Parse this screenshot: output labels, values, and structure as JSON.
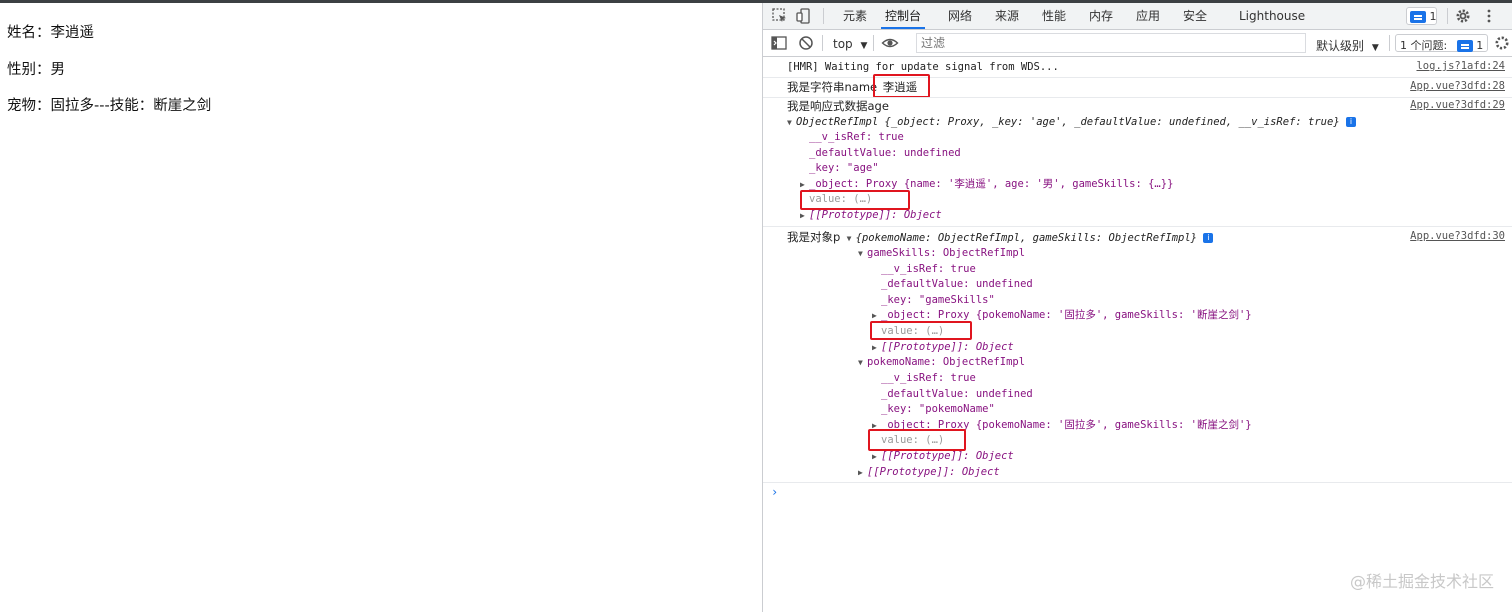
{
  "page": {
    "line1": "姓名：李逍遥",
    "line2": "性别：男",
    "line3": "宠物：固拉多---技能：断崖之剑"
  },
  "devtools": {
    "tabs": [
      "元素",
      "控制台",
      "网络",
      "来源",
      "性能",
      "内存",
      "应用",
      "安全",
      "Lighthouse"
    ],
    "active_tab": "控制台",
    "issues_badge": "1",
    "toolbar": {
      "context": "top",
      "filter_placeholder": "过滤",
      "level": "默认级别",
      "issues_label": "1 个问题:",
      "issues_count": "1"
    }
  },
  "console": {
    "hmr": "[HMR] Waiting for update signal from WDS...",
    "hmr_src": "log.js?1afd:24",
    "msg1_label": "我是字符串name",
    "msg1_value": "李逍遥",
    "msg1_src": "App.vue?3dfd:28",
    "msg2_label": "我是响应式数据age",
    "msg2_src": "App.vue?3dfd:29",
    "msg2_summary": "ObjectRefImpl {_object: Proxy, _key: 'age', _defaultValue: undefined, __v_isRef: true}",
    "msg2_props": {
      "isref": "__v_isRef: true",
      "default": "_defaultValue: undefined",
      "key": "_key: \"age\"",
      "object": "_object: Proxy {name: '李逍遥', age: '男', gameSkills: {…}}",
      "value": "value: (…)",
      "proto": "[[Prototype]]: Object"
    },
    "msg3_label": "我是对象p",
    "msg3_src": "App.vue?3dfd:30",
    "msg3_summary": "{pokemoName: ObjectRefImpl, gameSkills: ObjectRefImpl}",
    "gameSkills": {
      "head": "gameSkills: ObjectRefImpl",
      "isref": "__v_isRef: true",
      "default": "_defaultValue: undefined",
      "key": "_key: \"gameSkills\"",
      "object": "_object: Proxy {pokemoName: '固拉多', gameSkills: '断崖之剑'}",
      "value": "value: (…)",
      "proto": "[[Prototype]]: Object"
    },
    "pokemoName": {
      "head": "pokemoName: ObjectRefImpl",
      "isref": "__v_isRef: true",
      "default": "_defaultValue: undefined",
      "key": "_key: \"pokemoName\"",
      "object": "_object: Proxy {pokemoName: '固拉多', gameSkills: '断崖之剑'}",
      "value": "value: (…)",
      "proto": "[[Prototype]]: Object"
    },
    "outer_proto": "[[Prototype]]: Object",
    "prompt": "›"
  },
  "watermark": "@稀土掘金技术社区",
  "colors": {
    "accent": "#1a73e8",
    "highlight_box": "#e0151f",
    "string": "#c41a16",
    "key": "#881280"
  }
}
